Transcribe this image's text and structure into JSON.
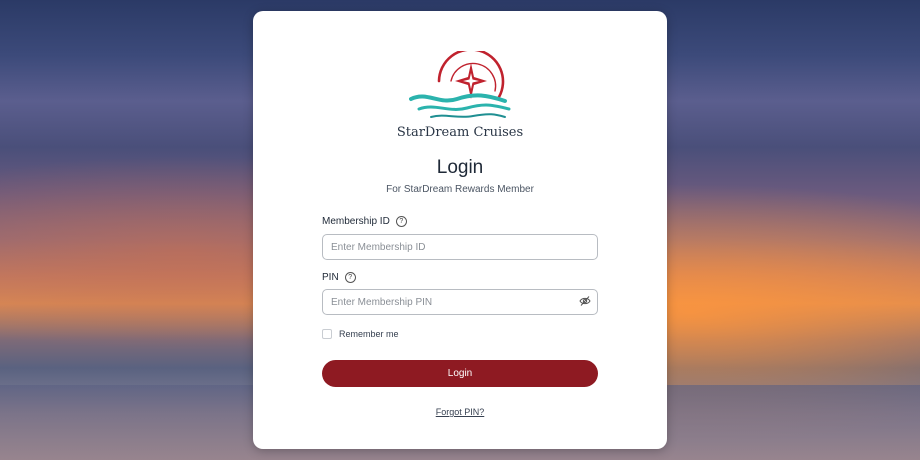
{
  "brand": {
    "name": "StarDream Cruises",
    "logo_icon": "star-wave-logo",
    "primary_color": "#8e1a22",
    "accent_color": "#2bb3ad"
  },
  "login": {
    "title": "Login",
    "subtitle": "For StarDream Rewards Member",
    "membership_id": {
      "label": "Membership ID",
      "placeholder": "Enter Membership ID",
      "help_icon": "help-circle-icon"
    },
    "pin": {
      "label": "PIN",
      "placeholder": "Enter Membership PIN",
      "help_icon": "help-circle-icon",
      "toggle_icon": "eye-off-icon"
    },
    "remember_label": "Remember me",
    "submit_label": "Login",
    "forgot_label": "Forgot PIN?"
  }
}
